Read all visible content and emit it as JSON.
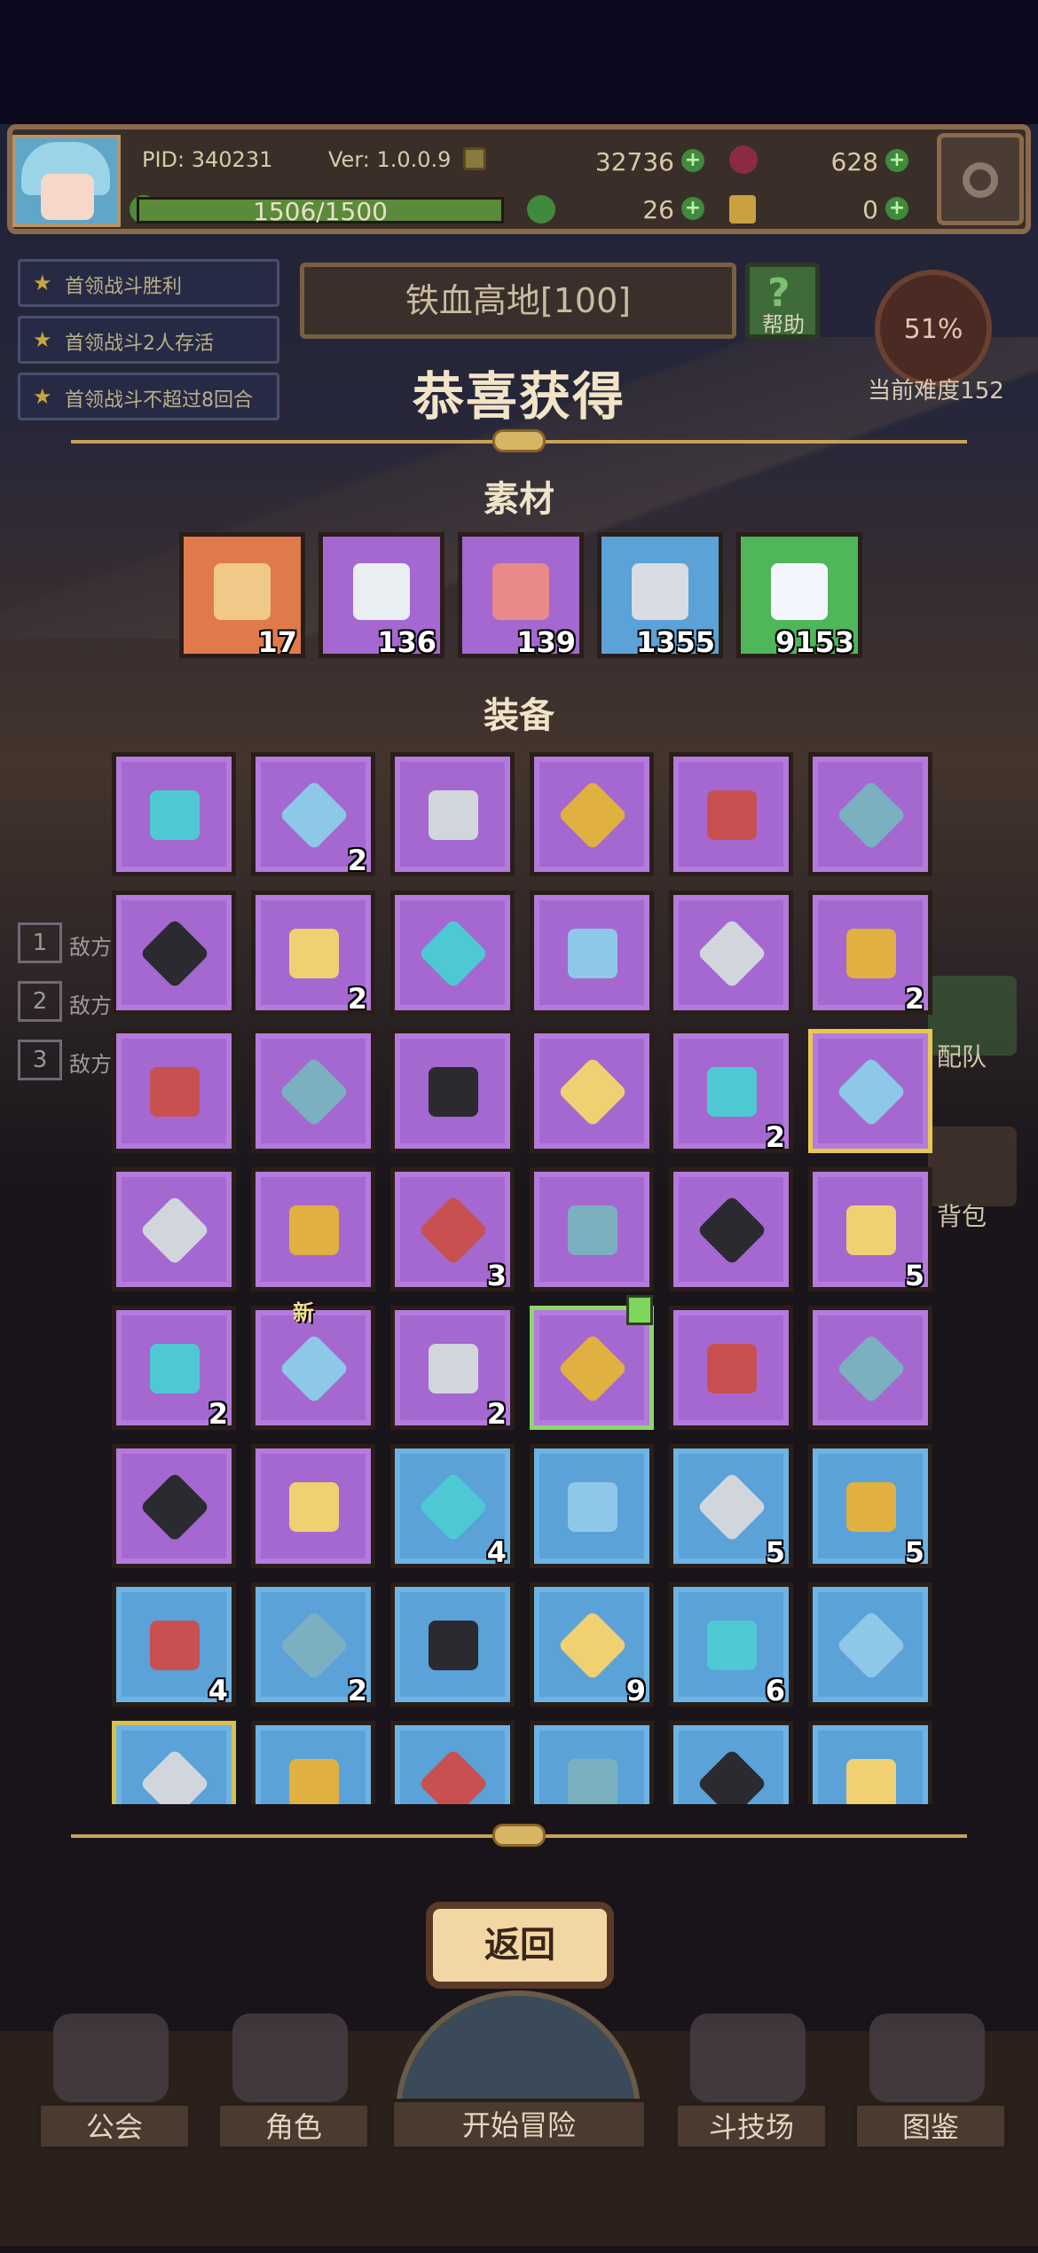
{
  "header": {
    "pid": "PID: 340231",
    "version": "Ver: 1.0.0.9",
    "gold": "32736",
    "gems": "628",
    "exp": "1506/1500",
    "clover": "26",
    "key": "0"
  },
  "quests": [
    "首领战斗胜利",
    "首领战斗2人存活",
    "首领战斗不超过8回合"
  ],
  "stage": {
    "name": "铁血高地[100]",
    "help": "帮助",
    "percent": "51%",
    "difficulty": "当前难度152"
  },
  "enemies": [
    {
      "num": "1",
      "label": "敌方"
    },
    {
      "num": "2",
      "label": "敌方"
    },
    {
      "num": "3",
      "label": "敌方"
    }
  ],
  "side_labels": {
    "team": "配队",
    "bag": "背包"
  },
  "modal": {
    "title": "恭喜获得",
    "materials_title": "素材",
    "equipment_title": "装备",
    "back_label": "返回",
    "new_tag": "新"
  },
  "materials": [
    {
      "icon": "hide-icon",
      "count": "17",
      "bg": "#e07a4a"
    },
    {
      "icon": "fish-icon",
      "count": "136",
      "bg": "#a468d0"
    },
    {
      "icon": "meat-icon",
      "count": "139",
      "bg": "#a468d0"
    },
    {
      "icon": "swordfish-icon",
      "count": "1355",
      "bg": "#5aa2d8"
    },
    {
      "icon": "crystal-icon",
      "count": "9153",
      "bg": "#4fb65a"
    }
  ],
  "equipment": [
    [
      {
        "icon": "mace-icon",
        "count": "",
        "rarity": "p"
      },
      {
        "icon": "ice-crystal-icon",
        "count": "2",
        "rarity": "p"
      },
      {
        "icon": "scimitar-icon",
        "count": "",
        "rarity": "p"
      },
      {
        "icon": "sword-icon",
        "count": "",
        "rarity": "p"
      },
      {
        "icon": "tome-icon",
        "count": "",
        "rarity": "p"
      },
      {
        "icon": "dagger-icon",
        "count": "",
        "rarity": "p"
      }
    ],
    [
      {
        "icon": "cape-icon",
        "count": "",
        "rarity": "p"
      },
      {
        "icon": "crown-icon",
        "count": "2",
        "rarity": "p"
      },
      {
        "icon": "dark-cape-icon",
        "count": "",
        "rarity": "p"
      },
      {
        "icon": "gold-armor-icon",
        "count": "",
        "rarity": "p"
      },
      {
        "icon": "robe-icon",
        "count": "",
        "rarity": "p"
      },
      {
        "icon": "shell-armor-icon",
        "count": "2",
        "rarity": "p"
      }
    ],
    [
      {
        "icon": "red-glove-icon",
        "count": "",
        "rarity": "p"
      },
      {
        "icon": "ice-gauntlet-icon",
        "count": "",
        "rarity": "p"
      },
      {
        "icon": "iron-glove-icon",
        "count": "",
        "rarity": "p"
      },
      {
        "icon": "gold-bracelet-icon",
        "count": "",
        "rarity": "p"
      },
      {
        "icon": "silver-bracelet-icon",
        "count": "2",
        "rarity": "p"
      },
      {
        "icon": "jeweled-bracelet-icon",
        "count": "",
        "rarity": "p gold"
      }
    ],
    [
      {
        "icon": "green-bracelet-icon",
        "count": "",
        "rarity": "p"
      },
      {
        "icon": "purple-boots-icon",
        "count": "",
        "rarity": "p"
      },
      {
        "icon": "gold-boots-icon",
        "count": "3",
        "rarity": "p"
      },
      {
        "icon": "red-boots-icon",
        "count": "",
        "rarity": "p"
      },
      {
        "icon": "iron-boots-icon",
        "count": "",
        "rarity": "p"
      },
      {
        "icon": "gem-amulet-icon",
        "count": "5",
        "rarity": "p"
      }
    ],
    [
      {
        "icon": "gold-necklace-icon",
        "count": "2",
        "rarity": "p"
      },
      {
        "icon": "ice-necklace-icon",
        "count": "",
        "rarity": "p"
      },
      {
        "icon": "heart-necklace-icon",
        "count": "2",
        "rarity": "p"
      },
      {
        "icon": "cross-necklace-icon",
        "count": "",
        "rarity": "p green"
      },
      {
        "icon": "ruby-necklace-icon",
        "count": "",
        "rarity": "p"
      },
      {
        "icon": "crystal-ring-icon",
        "count": "",
        "rarity": "p"
      }
    ],
    [
      {
        "icon": "teal-ring-icon",
        "count": "",
        "rarity": "p"
      },
      {
        "icon": "pearl-ring-icon",
        "count": "",
        "rarity": "p"
      },
      {
        "icon": "bow-icon",
        "count": "4",
        "rarity": "b"
      },
      {
        "icon": "staff-icon",
        "count": "",
        "rarity": "b"
      },
      {
        "icon": "heart-wand-icon",
        "count": "5",
        "rarity": "b"
      },
      {
        "icon": "knife-icon",
        "count": "5",
        "rarity": "b"
      }
    ],
    [
      {
        "icon": "crossbow-icon",
        "count": "4",
        "rarity": "b"
      },
      {
        "icon": "broadsword-icon",
        "count": "2",
        "rarity": "b"
      },
      {
        "icon": "spear-icon",
        "count": "",
        "rarity": "b"
      },
      {
        "icon": "rapier-icon",
        "count": "9",
        "rarity": "b"
      },
      {
        "icon": "gold-mace-icon",
        "count": "6",
        "rarity": "b"
      },
      {
        "icon": "lance-icon",
        "count": "",
        "rarity": "b"
      }
    ],
    [
      {
        "icon": "orb-icon",
        "count": "",
        "rarity": "b gb"
      },
      {
        "icon": "crystal-orb-icon",
        "count": "",
        "rarity": "b"
      },
      {
        "icon": "heart-shield-icon",
        "count": "",
        "rarity": "b"
      },
      {
        "icon": "cross-shield-icon",
        "count": "",
        "rarity": "b"
      },
      {
        "icon": "ruby-shield-icon",
        "count": "",
        "rarity": "b"
      },
      {
        "icon": "dark-orb-icon",
        "count": "",
        "rarity": "b"
      }
    ]
  ],
  "nav": [
    "公会",
    "角色",
    "开始冒险",
    "斗技场",
    "图鉴"
  ]
}
